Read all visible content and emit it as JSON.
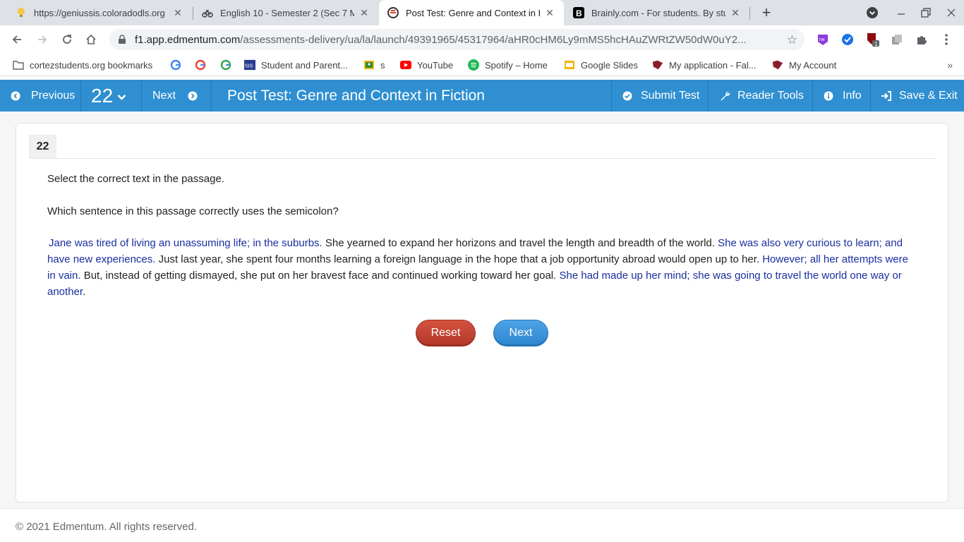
{
  "browser": {
    "tabs": [
      {
        "title": "https://geniussis.coloradodls.org",
        "icon": "lightbulb-icon",
        "active": false
      },
      {
        "title": "English 10 - Semester 2 (Sec 7 M",
        "icon": "bicycle-icon",
        "active": false
      },
      {
        "title": "Post Test: Genre and Context in F",
        "icon": "edmentum-icon",
        "active": true
      },
      {
        "title": "Brainly.com - For students. By stu",
        "icon": "brainly-icon",
        "active": false
      }
    ],
    "url_host": "f1.app.edmentum.com",
    "url_path": "/assessments-delivery/ua/la/launch/49391965/45317964/aHR0cHM6Ly9mMS5hcHAuZWRtZW50dW0uY2...",
    "bookmarks": [
      {
        "label": "cortezstudents.org bookmarks",
        "icon": "folder-icon"
      },
      {
        "label": "",
        "icon": "google-icon"
      },
      {
        "label": "",
        "icon": "google-icon"
      },
      {
        "label": "",
        "icon": "google-icon"
      },
      {
        "label": "Student and Parent...",
        "icon": "sis-icon"
      },
      {
        "label": "s",
        "icon": "classroom-icon"
      },
      {
        "label": "YouTube",
        "icon": "youtube-icon"
      },
      {
        "label": "Spotify – Home",
        "icon": "spotify-icon"
      },
      {
        "label": "Google Slides",
        "icon": "slides-icon"
      },
      {
        "label": "My application - Fal...",
        "icon": "bookmark-icon"
      },
      {
        "label": "My Account",
        "icon": "bookmark-icon"
      }
    ],
    "extension_badge": "1"
  },
  "header": {
    "previous": "Previous",
    "question_number": "22",
    "next": "Next",
    "title": "Post Test: Genre and Context in Fiction",
    "submit": "Submit Test",
    "reader_tools": "Reader Tools",
    "info": "Info",
    "save_exit": "Save & Exit"
  },
  "question": {
    "number": "22",
    "instruction": "Select the correct text in the passage.",
    "prompt": "Which sentence in this passage correctly uses the semicolon?",
    "passage": {
      "s1": "Jane was tired of living an unassuming life; in the suburbs.",
      "s2": "She yearned to expand her horizons and travel the length and breadth of the world.",
      "s3": "She was also very curious to learn; and have new experiences.",
      "s4": "Just last year, she spent four months learning a foreign language in the hope that a job opportunity abroad would open up to her.",
      "s5": "However; all her attempts were in vain.",
      "s6": "But, instead of getting dismayed, she put on her bravest face and continued working toward her goal.",
      "s7": "She had made up her mind; she was going to travel the world one way or another",
      "period": "."
    },
    "reset": "Reset",
    "next": "Next"
  },
  "footer": {
    "copyright": "© 2021 Edmentum. All rights reserved."
  },
  "colors": {
    "header_blue": "#2f8fd1",
    "selectable_text": "#1a2e9e",
    "reset_red": "#c0432f",
    "next_blue": "#3a95dc"
  }
}
